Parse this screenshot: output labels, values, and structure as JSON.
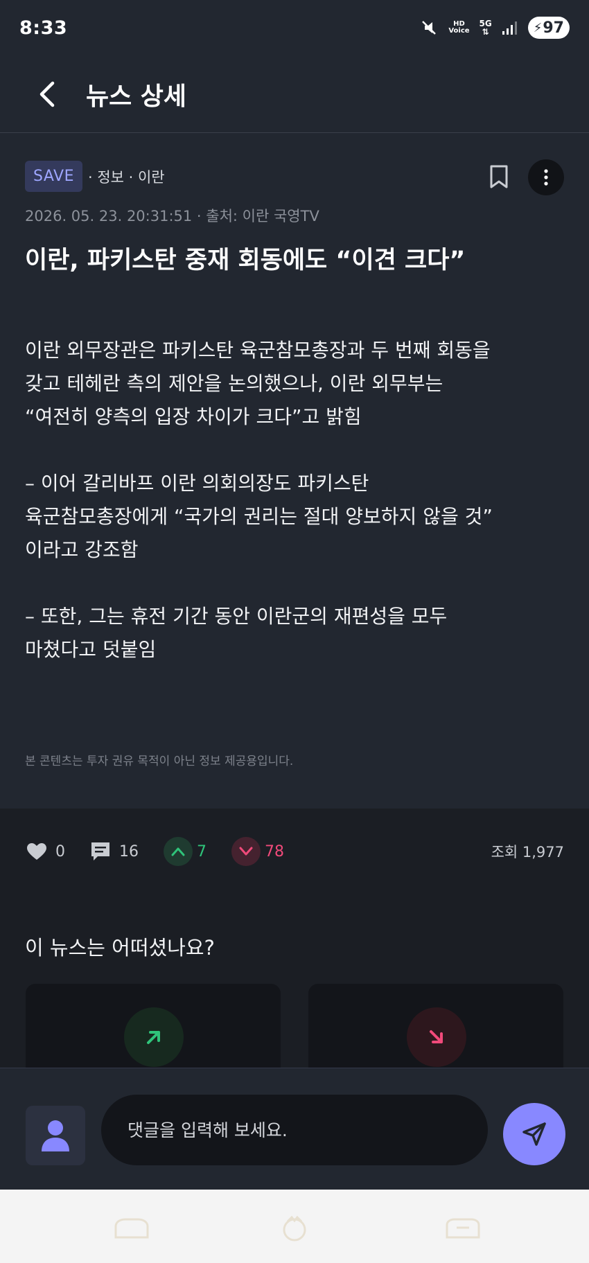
{
  "status_bar": {
    "time": "8:33",
    "hd_top": "HD",
    "hd_bottom": "Voice",
    "network": "5G",
    "battery": "97"
  },
  "header": {
    "title": "뉴스 상세"
  },
  "article": {
    "tag": "SAVE",
    "category": "· 정보 · 이란",
    "date": "2026. 05. 23. 20:31:51 · 출처: 이란 국영TV",
    "headline": "이란, 파키스탄 중재 회동에도 “이견 크다”",
    "paragraphs": [
      "이란 외무장관은 파키스탄 육군참모총장과 두 번째 회동을\n갖고 테헤란 측의 제안을 논의했으나, 이란 외무부는\n“여전히 양측의 입장 차이가 크다”고 밝힘",
      "– 이어 갈리바프 이란 의회의장도 파키스탄\n육군참모총장에게 “국가의 권리는 절대 양보하지 않을 것”\n이라고 강조함",
      "– 또한, 그는 휴전 기간 동안 이란군의 재편성을 모두\n마쳤다고 덧붙임"
    ],
    "disclaimer": "본 콘텐츠는 투자 권유 목적이 아닌 정보 제공용입니다."
  },
  "stats": {
    "likes": "0",
    "comments": "16",
    "upvotes": "7",
    "downvotes": "78",
    "views": "조회 1,977"
  },
  "feedback": {
    "title": "이 뉴스는 어떠셨나요?"
  },
  "comment": {
    "placeholder": "댓글을 입력해 보세요."
  },
  "colors": {
    "background": "#222730",
    "accent": "#8888ff",
    "up": "#2fc47a",
    "down": "#f04a7a"
  }
}
